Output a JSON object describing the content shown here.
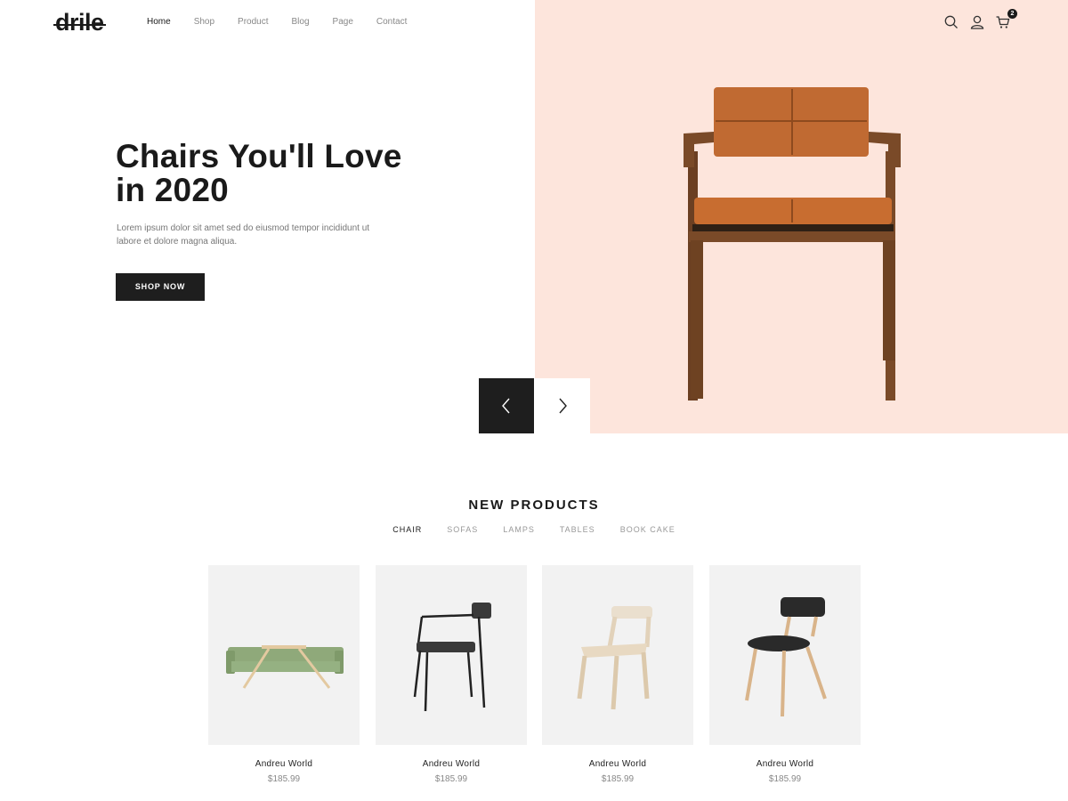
{
  "brand": {
    "logo_text": "drile"
  },
  "nav": {
    "items": [
      {
        "label": "Home",
        "active": true
      },
      {
        "label": "Shop",
        "active": false
      },
      {
        "label": "Product",
        "active": false
      },
      {
        "label": "Blog",
        "active": false
      },
      {
        "label": "Page",
        "active": false
      },
      {
        "label": "Contact",
        "active": false
      }
    ]
  },
  "header_icons": {
    "search": "search-icon",
    "account": "user-icon",
    "cart": "cart-icon",
    "cart_count": "2"
  },
  "hero": {
    "title": "Chairs You'll Love in 2020",
    "description": "Lorem ipsum dolor sit amet sed do eiusmod tempor incididunt ut labore et dolore magna aliqua.",
    "cta_label": "SHOP NOW",
    "background_color": "#fde5dc"
  },
  "slider": {
    "prev_icon": "chevron-left-icon",
    "next_icon": "chevron-right-icon"
  },
  "new_products": {
    "title": "NEW PRODUCTS",
    "tabs": [
      {
        "label": "CHAIR",
        "active": true
      },
      {
        "label": "SOFAS",
        "active": false
      },
      {
        "label": "LAMPS",
        "active": false
      },
      {
        "label": "TABLES",
        "active": false
      },
      {
        "label": "BOOK CAKE",
        "active": false
      }
    ],
    "products": [
      {
        "name": "Andreu World",
        "price": "$185.99"
      },
      {
        "name": "Andreu World",
        "price": "$185.99"
      },
      {
        "name": "Andreu World",
        "price": "$185.99"
      },
      {
        "name": "Andreu World",
        "price": "$185.99"
      }
    ]
  }
}
